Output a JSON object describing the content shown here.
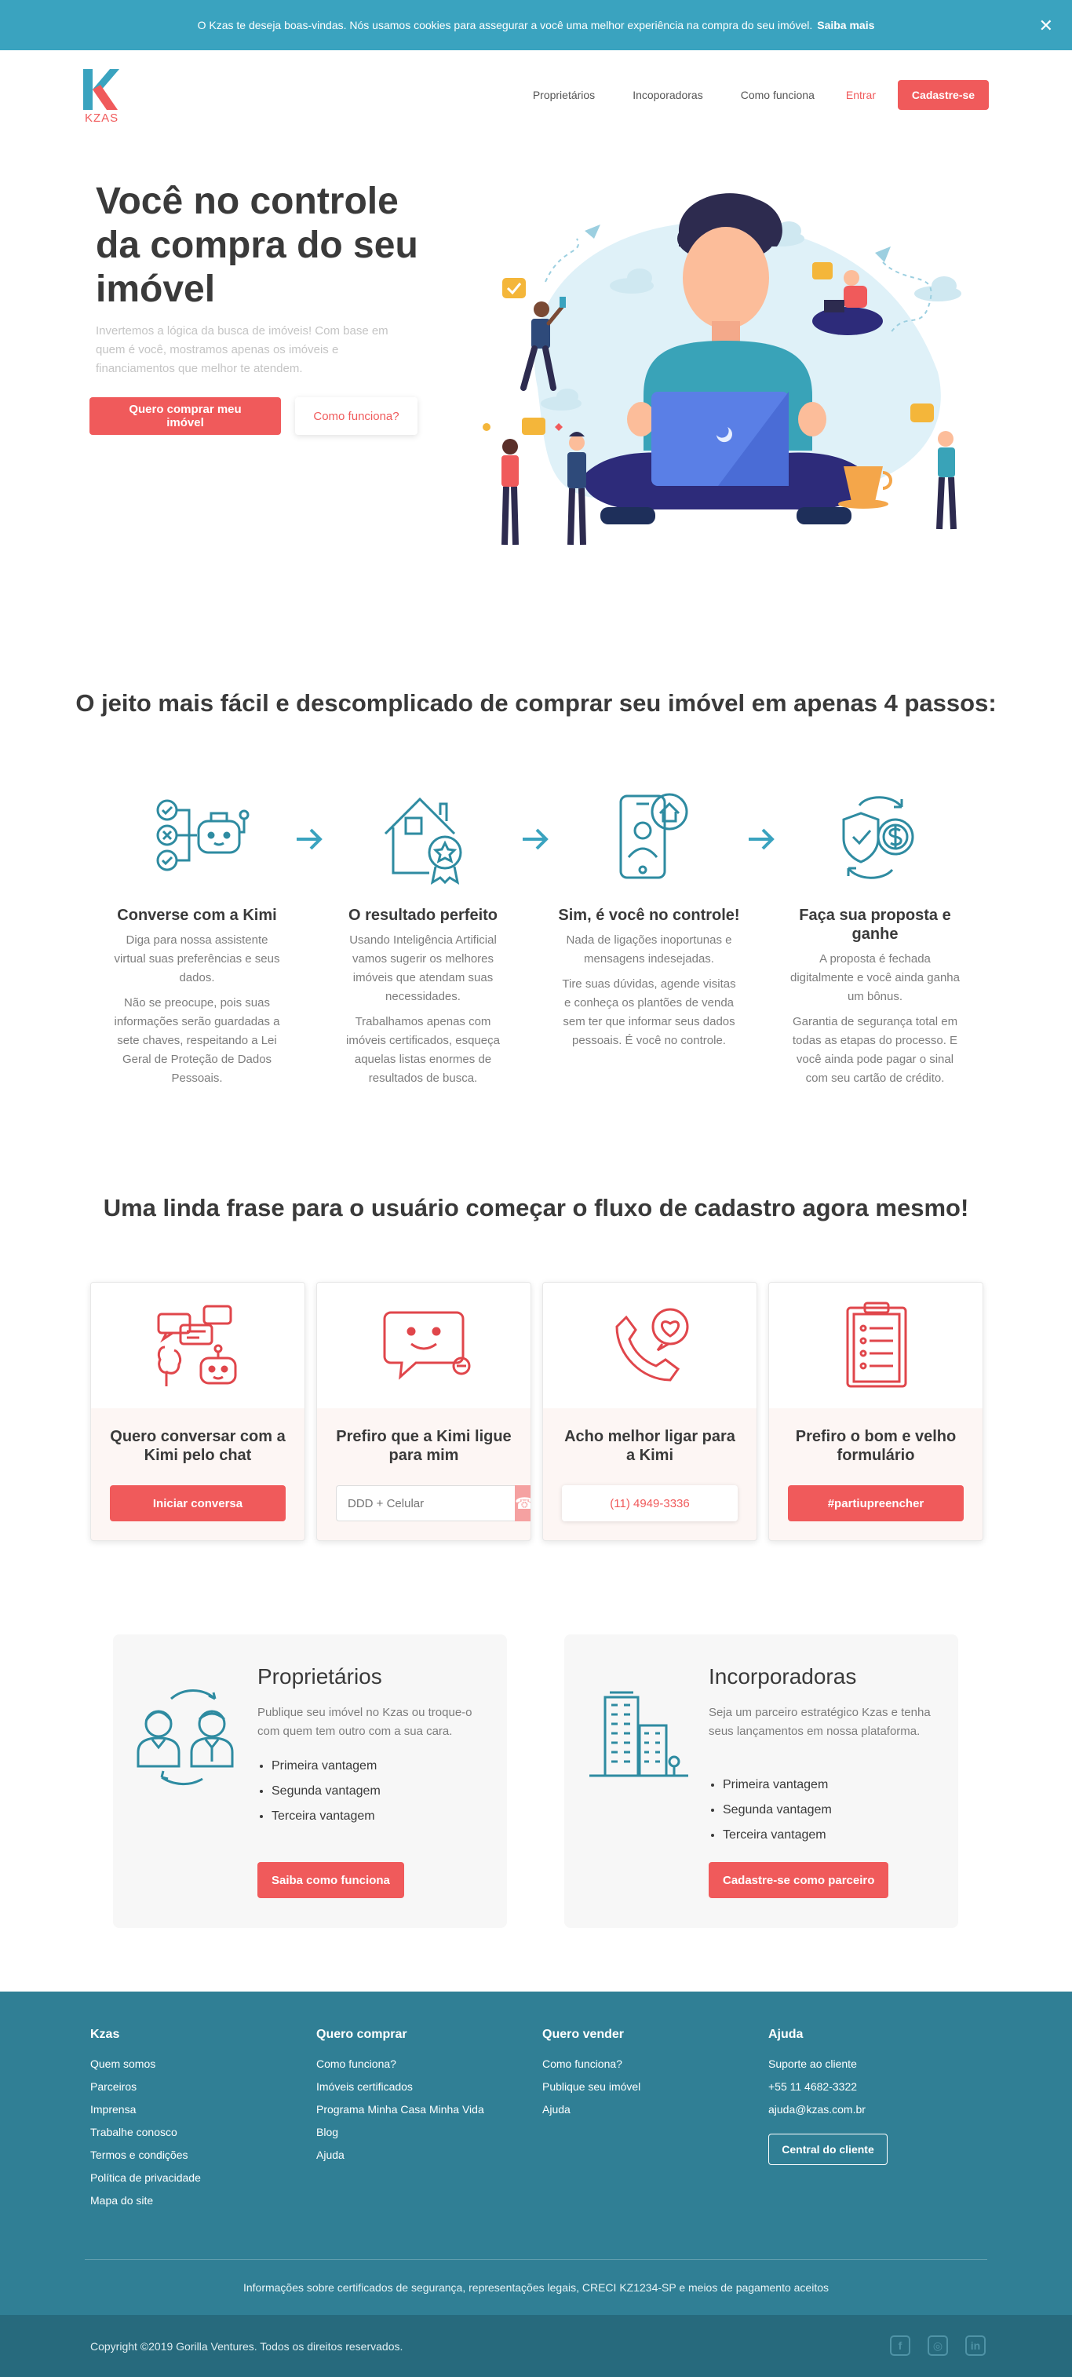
{
  "cookie": {
    "text": "O Kzas te deseja boas-vindas. Nós usamos cookies para assegurar a você uma melhor experiência na compra do seu imóvel.",
    "link": "Saiba mais",
    "close": "✕"
  },
  "header": {
    "logo_text": "KZAS",
    "nav": [
      "Proprietários",
      "Incoporadoras",
      "Como funciona"
    ],
    "login": "Entrar",
    "signup": "Cadastre-se"
  },
  "hero": {
    "title": "Você no controle da compra do seu imóvel",
    "subtitle": "Invertemos a lógica da busca de imóveis! Com base em quem é você, mostramos apenas os imóveis e financiamentos que melhor te atendem.",
    "cta_primary": "Quero comprar meu imóvel",
    "cta_secondary": "Como funciona?"
  },
  "steps": {
    "title": "O jeito mais fácil e descomplicado de comprar seu imóvel em apenas 4 passos:",
    "items": [
      {
        "title": "Converse com a Kimi",
        "p1": "Diga para nossa assistente virtual suas preferências e seus dados.",
        "p2": "Não se preocupe, pois suas informações serão guardadas a sete chaves, respeitando a Lei Geral de Proteção de Dados Pessoais."
      },
      {
        "title": "O resultado perfeito",
        "p1": "Usando Inteligência Artificial vamos sugerir os melhores imóveis que atendam suas necessidades.",
        "p2": "Trabalhamos apenas com imóveis certificados, esqueça aquelas listas enormes de resultados de busca."
      },
      {
        "title": "Sim, é você no controle!",
        "p1": "Nada de ligações inoportunas e mensagens indesejadas.",
        "p2": "Tire suas dúvidas, agende visitas e conheça os plantões de venda sem ter que informar seus dados pessoais. É você no controle."
      },
      {
        "title": "Faça sua proposta e ganhe",
        "p1": "A proposta é fechada digitalmente e você ainda ganha um bônus.",
        "p2": "Garantia de segurança total em todas as etapas do processo. E você ainda pode pagar o sinal com seu cartão de crédito."
      }
    ]
  },
  "cards": {
    "title": "Uma linda frase para o usuário começar o fluxo de cadastro agora mesmo!",
    "chat": {
      "title": "Quero conversar com a Kimi pelo chat",
      "button": "Iniciar conversa"
    },
    "call": {
      "title": "Prefiro que a Kimi ligue para mim",
      "placeholder": "DDD + Celular"
    },
    "phone": {
      "title": "Acho melhor ligar para a Kimi",
      "button": "(11) 4949-3336"
    },
    "form": {
      "title": "Prefiro o bom e velho formulário",
      "button": "#partiupreencher"
    }
  },
  "partners": {
    "owners": {
      "title": "Proprietários",
      "text": "Publique seu imóvel no Kzas ou troque-o com quem tem outro com a sua cara.",
      "items": [
        "Primeira vantagem",
        "Segunda vantagem",
        "Terceira vantagem"
      ],
      "button": "Saiba como funciona"
    },
    "builders": {
      "title": "Incorporadoras",
      "text": "Seja um parceiro estratégico Kzas e tenha seus lançamentos em nossa plataforma.",
      "items": [
        "Primeira vantagem",
        "Segunda vantagem",
        "Terceira vantagem"
      ],
      "button": "Cadastre-se como parceiro"
    }
  },
  "footer": {
    "cols": [
      {
        "title": "Kzas",
        "links": [
          "Quem somos",
          "Parceiros",
          "Imprensa",
          "Trabalhe conosco",
          "Termos e condições",
          "Política de privacidade",
          "Mapa do site"
        ]
      },
      {
        "title": "Quero comprar",
        "links": [
          "Como funciona?",
          "Imóveis certificados",
          "Programa Minha Casa Minha Vida",
          "Blog",
          "Ajuda"
        ]
      },
      {
        "title": "Quero vender",
        "links": [
          "Como funciona?",
          "Publique seu imóvel",
          "Ajuda"
        ]
      },
      {
        "title": "Ajuda",
        "links": [
          "Suporte ao cliente",
          "+55 11 4682-3322",
          "ajuda@kzas.com.br"
        ],
        "button": "Central do cliente"
      }
    ],
    "legal": "Informações sobre certificados de segurança, representações legais, CRECI KZ1234-SP e meios de pagamento aceitos",
    "copyright": "Copyright ©2019 Gorilla Ventures. Todos os direitos reservados.",
    "social": [
      "f",
      "◎",
      "in"
    ]
  },
  "colors": {
    "primary": "#f05a5b",
    "teal": "#307f95",
    "cookie": "#3aa3bf",
    "icon": "#2e8ba1"
  }
}
